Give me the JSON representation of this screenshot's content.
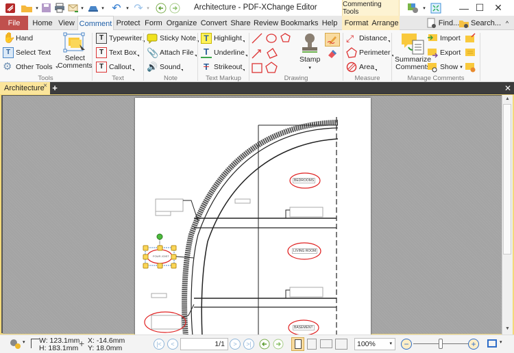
{
  "window": {
    "title": "Architecture - PDF-XChange Editor",
    "context_tab_group": "Commenting Tools",
    "minimize_label": "—",
    "maximize_label": "☐",
    "close_label": "✕"
  },
  "menu_tabs": [
    {
      "label": "File"
    },
    {
      "label": "Home"
    },
    {
      "label": "View"
    },
    {
      "label": "Comment"
    },
    {
      "label": "Protect"
    },
    {
      "label": "Form"
    },
    {
      "label": "Organize"
    },
    {
      "label": "Convert"
    },
    {
      "label": "Share"
    },
    {
      "label": "Review"
    },
    {
      "label": "Bookmarks"
    },
    {
      "label": "Help"
    },
    {
      "label": "Format"
    },
    {
      "label": "Arrange"
    }
  ],
  "active_tab": "Comment",
  "search": {
    "find_label": "Find...",
    "search_label": "Search..."
  },
  "ribbon": {
    "tools": {
      "label": "Tools",
      "hand": "Hand",
      "select_text": "Select Text",
      "other_tools": "Other Tools",
      "select_comments_1": "Select",
      "select_comments_2": "Comments"
    },
    "text": {
      "label": "Text",
      "typewriter": "Typewriter",
      "text_box": "Text Box",
      "callout": "Callout"
    },
    "note": {
      "label": "Note",
      "sticky_note": "Sticky Note",
      "attach_file": "Attach File",
      "sound": "Sound"
    },
    "text_markup": {
      "label": "Text Markup",
      "highlight": "Highlight",
      "underline": "Underline",
      "strikeout": "Strikeout"
    },
    "drawing": {
      "label": "Drawing",
      "stamp": "Stamp"
    },
    "measure": {
      "label": "Measure",
      "distance": "Distance",
      "perimeter": "Perimeter",
      "area": "Area"
    },
    "manage": {
      "label": "Manage Comments",
      "summarize_1": "Summarize",
      "summarize_2": "Comments",
      "import": "Import",
      "export": "Export",
      "show": "Show"
    }
  },
  "document_tab": {
    "label": "Architecture",
    "close": "×",
    "new_tab": "+"
  },
  "drawing_labels": {
    "bedrooms": "BEDROOMS",
    "living_room": "LIVING ROOM",
    "basement": "BASEMENT",
    "selected_note": "FOUR JOIST"
  },
  "status": {
    "width": "W: 123.1mm",
    "height": "H: 183.1mm",
    "x": "X:  -14.6mm",
    "y": "Y:    18.0mm",
    "page_field": "1/1",
    "zoom_value": "100%"
  },
  "zoom_slider_fraction": 0.5
}
